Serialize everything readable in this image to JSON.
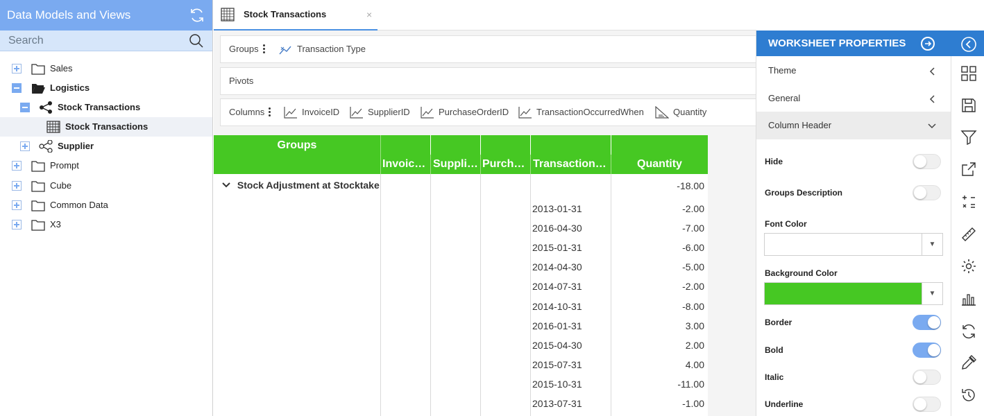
{
  "sidebar": {
    "title": "Data Models and Views",
    "search_placeholder": "Search",
    "items": [
      {
        "label": "Sales"
      },
      {
        "label": "Logistics"
      },
      {
        "label": "Stock Transactions"
      },
      {
        "label": "Stock Transactions"
      },
      {
        "label": "Supplier"
      },
      {
        "label": "Prompt"
      },
      {
        "label": "Cube"
      },
      {
        "label": "Common Data"
      },
      {
        "label": "X3"
      }
    ]
  },
  "tab": {
    "label": "Stock Transactions",
    "close": "×"
  },
  "bars": {
    "groups_label": "Groups",
    "groups_chip": "Transaction Type",
    "pivots_label": "Pivots",
    "columns_label": "Columns",
    "columns": [
      "InvoiceID",
      "SupplierID",
      "PurchaseOrderID",
      "TransactionOccurredWhen",
      "Quantity"
    ]
  },
  "grid": {
    "groups_header": "Groups",
    "headers": [
      "Invoic…",
      "Suppli…",
      "Purch…",
      "Transaction…",
      "Quantity"
    ],
    "group_row": {
      "label": "Stock Adjustment at Stocktake",
      "quantity": "-18.00"
    },
    "rows": [
      {
        "date": "2013-01-31",
        "qty": "-2.00"
      },
      {
        "date": "2016-04-30",
        "qty": "-7.00"
      },
      {
        "date": "2015-01-31",
        "qty": "-6.00"
      },
      {
        "date": "2014-04-30",
        "qty": "-5.00"
      },
      {
        "date": "2014-07-31",
        "qty": "-2.00"
      },
      {
        "date": "2014-10-31",
        "qty": "-8.00"
      },
      {
        "date": "2016-01-31",
        "qty": "3.00"
      },
      {
        "date": "2015-04-30",
        "qty": "2.00"
      },
      {
        "date": "2015-07-31",
        "qty": "4.00"
      },
      {
        "date": "2015-10-31",
        "qty": "-11.00"
      },
      {
        "date": "2013-07-31",
        "qty": "-1.00"
      }
    ]
  },
  "props": {
    "title": "WORKSHEET PROPERTIES",
    "sections": [
      "Theme",
      "General",
      "Column Header"
    ],
    "hide": "Hide",
    "groups_description": "Groups Description",
    "font_color": "Font Color",
    "background_color": "Background Color",
    "border": "Border",
    "bold": "Bold",
    "italic": "Italic",
    "underline": "Underline",
    "bg_color_value": "#46c823",
    "toggles": {
      "hide": false,
      "groups_description": false,
      "border": true,
      "bold": true,
      "italic": false,
      "underline": false
    }
  },
  "colors": {
    "header_green": "#46c823",
    "accent_blue": "#2e7dd1",
    "sidebar_blue": "#7aaaf0"
  },
  "rail_icons": [
    "back-icon",
    "layout-grid-icon",
    "save-icon",
    "filter-icon",
    "export-icon",
    "calculator-icon",
    "ruler-icon",
    "settings-icon",
    "bar-chart-icon",
    "refresh-icon",
    "eyedropper-icon",
    "history-icon"
  ]
}
